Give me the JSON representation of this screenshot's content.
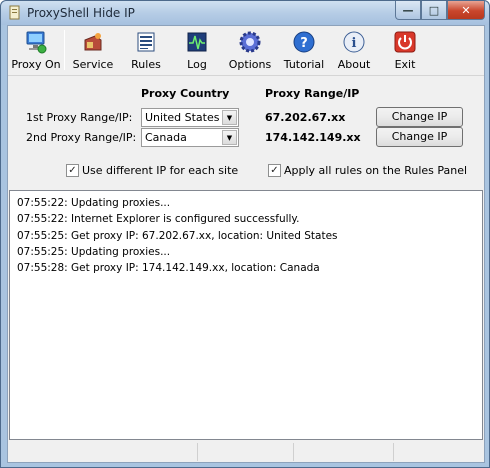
{
  "window": {
    "title": "ProxyShell Hide IP"
  },
  "toolbar": {
    "items": [
      {
        "label": "Proxy On",
        "icon": "computer-network-icon"
      },
      {
        "label": "Service",
        "icon": "service-icon"
      },
      {
        "label": "Rules",
        "icon": "rules-icon"
      },
      {
        "label": "Log",
        "icon": "log-icon"
      },
      {
        "label": "Options",
        "icon": "gear-icon"
      },
      {
        "label": "Tutorial",
        "icon": "help-icon"
      },
      {
        "label": "About",
        "icon": "info-icon"
      },
      {
        "label": "Exit",
        "icon": "power-icon"
      }
    ]
  },
  "proxy": {
    "country_header": "Proxy Country",
    "range_header": "Proxy Range/IP",
    "rows": [
      {
        "label": "1st Proxy Range/IP:",
        "country": "United States",
        "ip": "67.202.67.xx",
        "button": "Change IP"
      },
      {
        "label": "2nd Proxy Range/IP:",
        "country": "Canada",
        "ip": "174.142.149.xx",
        "button": "Change IP"
      }
    ],
    "options": [
      {
        "label": "Use different IP for each site",
        "checked": true
      },
      {
        "label": "Apply all rules on the Rules Panel",
        "checked": true
      }
    ]
  },
  "log": {
    "lines": [
      "07:55:22: Updating proxies...",
      "07:55:22: Internet Explorer is configured successfully.",
      "07:55:25: Get proxy IP: 67.202.67.xx, location: United States",
      "07:55:25: Updating proxies...",
      "07:55:28: Get proxy IP:  174.142.149.xx, location: Canada"
    ]
  },
  "colors": {
    "accent": "#2a5fa8",
    "close": "#c9462c"
  }
}
